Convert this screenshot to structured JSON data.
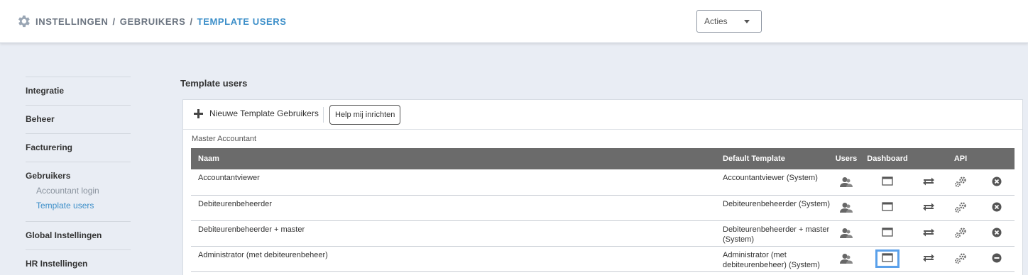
{
  "breadcrumb": {
    "icon": "gear-icon",
    "part1": "INSTELLINGEN",
    "part2": "GEBRUIKERS",
    "current": "TEMPLATE USERS",
    "separator": "/"
  },
  "actions": {
    "label": "Acties"
  },
  "sidebar": {
    "groups": [
      {
        "title": "Integratie"
      },
      {
        "title": "Beheer"
      },
      {
        "title": "Facturering"
      },
      {
        "title": "Gebruikers",
        "subitems": [
          "Accountant login",
          "Template users"
        ],
        "active_sub": "Template users"
      },
      {
        "title": "Global Instellingen"
      },
      {
        "title": "HR Instellingen"
      }
    ]
  },
  "page": {
    "section_title": "Template users"
  },
  "toolbar": {
    "new_label": "Nieuwe Template Gebruikers",
    "new_icon": "plus-icon",
    "help_label": "Help mij inrichten"
  },
  "group_label": "Master Accountant",
  "table": {
    "columns": {
      "naam": "Naam",
      "default_template": "Default Template",
      "users": "Users",
      "dashboard": "Dashboard",
      "sync": "",
      "api": "API",
      "action": ""
    },
    "rows": [
      {
        "naam": "Accountantviewer",
        "default_template": "Accountantviewer (System)",
        "status_icon": "remove-circle-icon"
      },
      {
        "naam": "Debiteurenbeheerder",
        "default_template": "Debiteurenbeheerder (System)",
        "status_icon": "remove-circle-icon"
      },
      {
        "naam": "Debiteurenbeheerder + master",
        "default_template": "Debiteurenbeheerder + master (System)",
        "status_icon": "remove-circle-icon"
      },
      {
        "naam": "Administrator (met debiteurenbeheer)",
        "default_template": "Administrator (met debiteurenbeheer) (System)",
        "status_icon": "minus-circle-icon",
        "dashboard_selected": true
      }
    ]
  },
  "colors": {
    "accent": "#3d8fc9",
    "header_bg": "#6b6b6b",
    "selection": "#5aa0ea"
  }
}
